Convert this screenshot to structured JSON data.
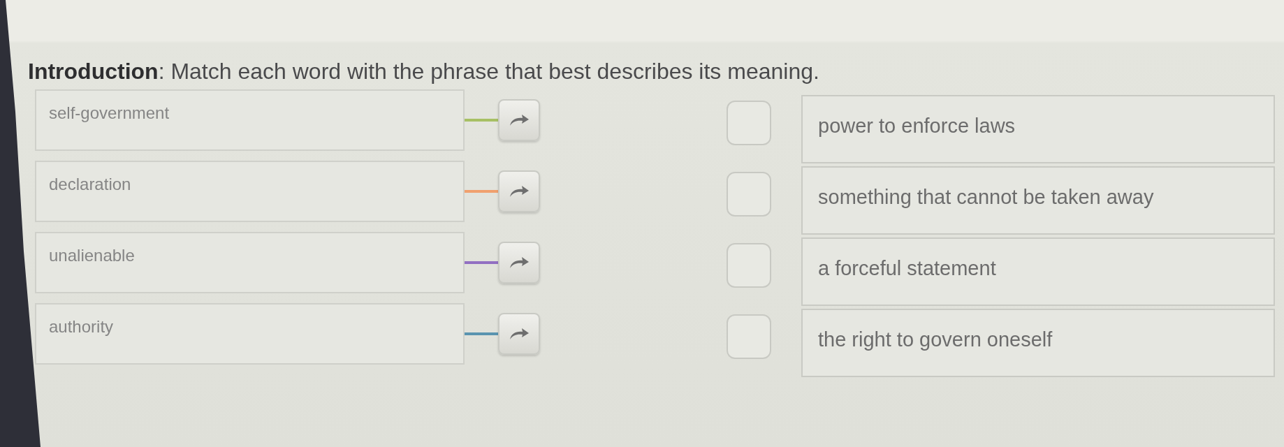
{
  "instructions": "**Introduction**: Match each word with the phrase that best describes its meaning.",
  "words": [
    {
      "text": "self-government",
      "color": "#a7c064"
    },
    {
      "text": "declaration",
      "color": "#f0a06e"
    },
    {
      "text": "unalienable",
      "color": "#9270c2"
    },
    {
      "text": "authority",
      "color": "#5a94b0"
    }
  ],
  "phrases": [
    {
      "text": "power to enforce laws",
      "checked": false
    },
    {
      "text": "something that cannot be taken away",
      "checked": false
    },
    {
      "text": "a forceful statement",
      "checked": false
    },
    {
      "text": "the right to govern oneself",
      "checked": false
    }
  ]
}
